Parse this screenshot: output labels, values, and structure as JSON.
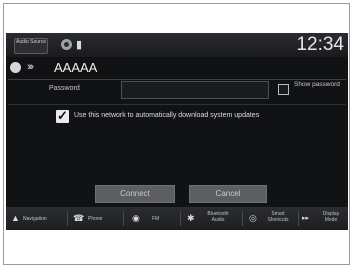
{
  "status_bar": {
    "audio_source_label": "Audio Source",
    "clock": "12:34"
  },
  "header": {
    "network_name": "AAAAA"
  },
  "password": {
    "label": "Password",
    "value": ""
  },
  "show_password": {
    "label": "Show password",
    "checked": false
  },
  "auto_download": {
    "label": "Use this network to automatically download system updates",
    "checked": true
  },
  "actions": {
    "connect_label": "Connect",
    "cancel_label": "Cancel"
  },
  "bottom_nav": {
    "navigation": "Navigation",
    "phone": "Phone",
    "fm": "FM",
    "bluetooth_audio": "Bluetooth Audio",
    "smart_shortcuts": "Smart Shortcuts",
    "display_mode": "Display Mode"
  }
}
